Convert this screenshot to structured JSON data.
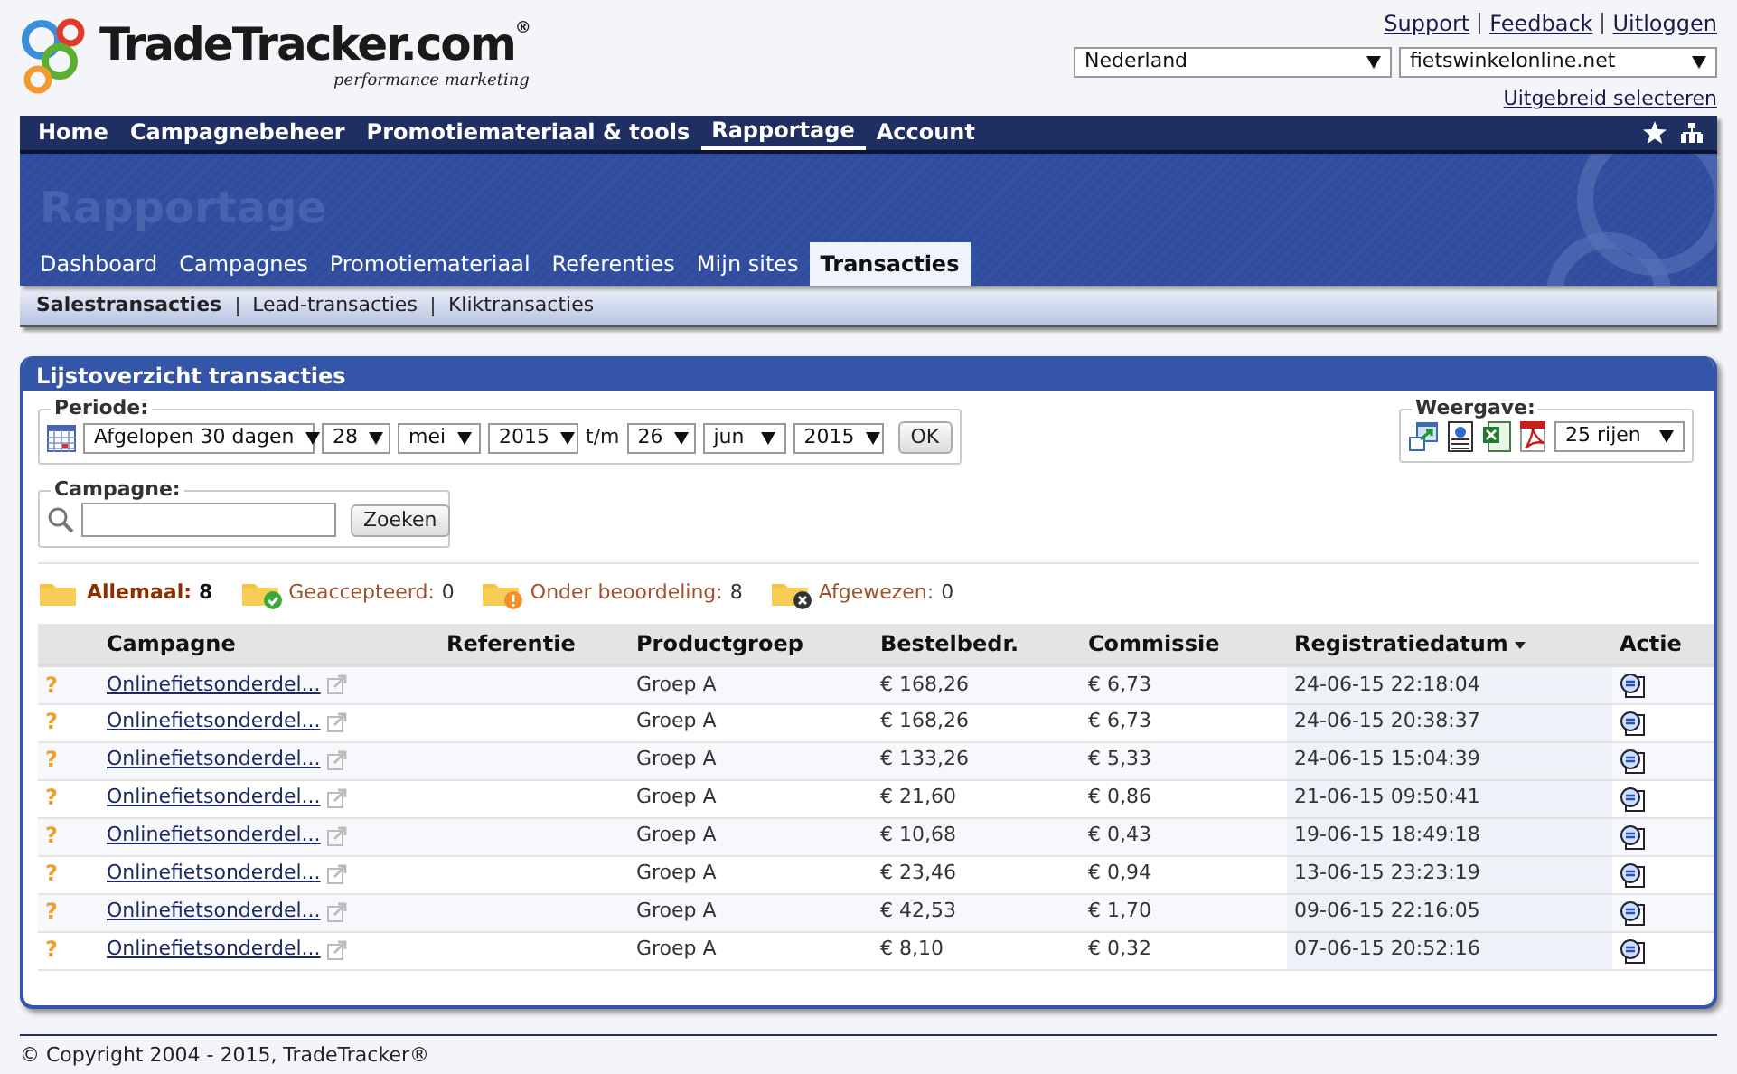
{
  "logo": {
    "name": "TradeTracker.com",
    "mark": "®",
    "tagline": "performance marketing"
  },
  "top_links": [
    "Support",
    "Feedback",
    "Uitloggen"
  ],
  "country_select": {
    "value": "Nederland"
  },
  "site_select": {
    "value": "fietswinkelonline.net"
  },
  "advanced_link": "Uitgebreid selecteren",
  "main_nav": [
    {
      "label": "Home",
      "selected": false
    },
    {
      "label": "Campagnebeheer",
      "selected": false
    },
    {
      "label": "Promotiemateriaal & tools",
      "selected": false
    },
    {
      "label": "Rapportage",
      "selected": true
    },
    {
      "label": "Account",
      "selected": false
    }
  ],
  "banner_title": "Rapportage",
  "sub_tabs": [
    {
      "label": "Dashboard",
      "selected": false
    },
    {
      "label": "Campagnes",
      "selected": false
    },
    {
      "label": "Promotiemateriaal",
      "selected": false
    },
    {
      "label": "Referenties",
      "selected": false
    },
    {
      "label": "Mijn sites",
      "selected": false
    },
    {
      "label": "Transacties",
      "selected": true
    }
  ],
  "sub_nav": [
    {
      "label": "Salestransacties",
      "selected": true
    },
    {
      "label": "Lead-transacties",
      "selected": false
    },
    {
      "label": "Kliktransacties",
      "selected": false
    }
  ],
  "panel": {
    "title": "Lijstoverzicht transacties",
    "periode": {
      "legend": "Periode:",
      "preset": "Afgelopen 30 dagen",
      "from_day": "28",
      "from_month": "mei",
      "from_year": "2015",
      "separator": "t/m",
      "to_day": "26",
      "to_month": "jun",
      "to_year": "2015",
      "ok": "OK"
    },
    "weergave": {
      "legend": "Weergave:",
      "rows": "25 rijen"
    },
    "campagne": {
      "legend": "Campagne:",
      "button": "Zoeken"
    },
    "status_filters": [
      {
        "kind": "all",
        "label": "Allemaal:",
        "count": "8",
        "selected": true
      },
      {
        "kind": "accepted",
        "label": "Geaccepteerd:",
        "count": "0",
        "selected": false
      },
      {
        "kind": "pending",
        "label": "Onder beoordeling:",
        "count": "8",
        "selected": false
      },
      {
        "kind": "rejected",
        "label": "Afgewezen:",
        "count": "0",
        "selected": false
      }
    ],
    "table": {
      "columns": [
        {
          "label": "Campagne",
          "sorted": false
        },
        {
          "label": "Referentie",
          "sorted": false
        },
        {
          "label": "Productgroep",
          "sorted": false
        },
        {
          "label": "Bestelbedr.",
          "sorted": false
        },
        {
          "label": "Commissie",
          "sorted": false
        },
        {
          "label": "Registratiedatum",
          "sorted": true
        },
        {
          "label": "Actie",
          "sorted": false
        }
      ],
      "rows": [
        {
          "status": "?",
          "campaign": "Onlinefietsonderdel...",
          "group": "Groep A",
          "amount": "€ 168,26",
          "commission": "€ 6,73",
          "date": "24-06-15 22:18:04"
        },
        {
          "status": "?",
          "campaign": "Onlinefietsonderdel...",
          "group": "Groep A",
          "amount": "€ 168,26",
          "commission": "€ 6,73",
          "date": "24-06-15 20:38:37"
        },
        {
          "status": "?",
          "campaign": "Onlinefietsonderdel...",
          "group": "Groep A",
          "amount": "€ 133,26",
          "commission": "€ 5,33",
          "date": "24-06-15 15:04:39"
        },
        {
          "status": "?",
          "campaign": "Onlinefietsonderdel...",
          "group": "Groep A",
          "amount": "€ 21,60",
          "commission": "€ 0,86",
          "date": "21-06-15 09:50:41"
        },
        {
          "status": "?",
          "campaign": "Onlinefietsonderdel...",
          "group": "Groep A",
          "amount": "€ 10,68",
          "commission": "€ 0,43",
          "date": "19-06-15 18:49:18"
        },
        {
          "status": "?",
          "campaign": "Onlinefietsonderdel...",
          "group": "Groep A",
          "amount": "€ 23,46",
          "commission": "€ 0,94",
          "date": "13-06-15 23:23:19"
        },
        {
          "status": "?",
          "campaign": "Onlinefietsonderdel...",
          "group": "Groep A",
          "amount": "€ 42,53",
          "commission": "€ 1,70",
          "date": "09-06-15 22:16:05"
        },
        {
          "status": "?",
          "campaign": "Onlinefietsonderdel...",
          "group": "Groep A",
          "amount": "€ 8,10",
          "commission": "€ 0,32",
          "date": "07-06-15 20:52:16"
        }
      ]
    }
  },
  "footer": "© Copyright 2004 - 2015, TradeTracker®"
}
